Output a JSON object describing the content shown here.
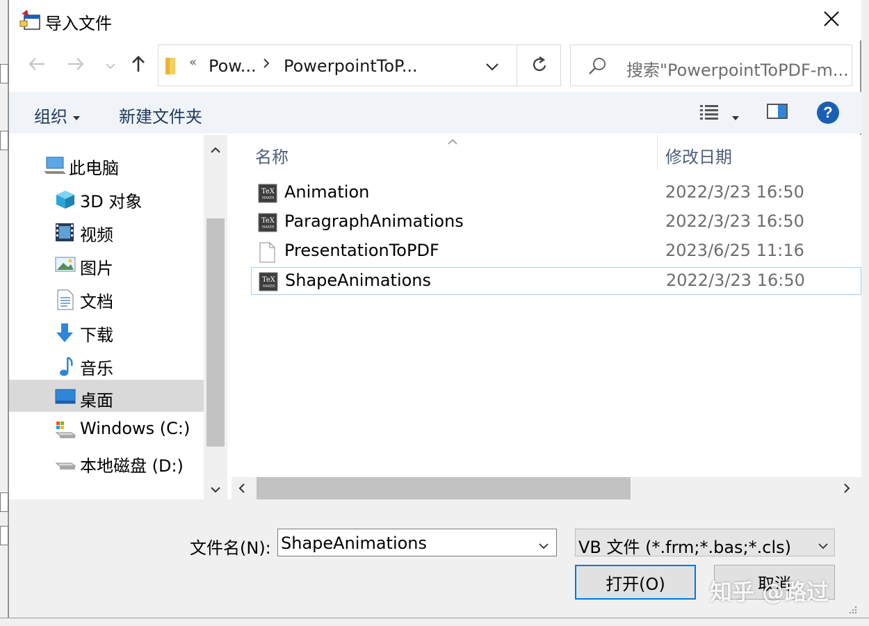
{
  "dialog": {
    "title": "导入文件",
    "close_icon": "close-icon"
  },
  "nav": {
    "back_icon": "arrow-left-icon",
    "forward_icon": "arrow-right-icon",
    "recent_icon": "chevron-down-icon",
    "up_icon": "arrow-up-icon"
  },
  "address": {
    "overflow": "«",
    "crumb1": "Pow...",
    "crumb2": "PowerpointToP..."
  },
  "search": {
    "placeholder": "搜索\"PowerpointToPDF-m..."
  },
  "toolbar": {
    "organize": "组织",
    "new_folder": "新建文件夹",
    "help": "?"
  },
  "sidebar": {
    "items": [
      {
        "label": "此电脑",
        "icon": "computer-icon"
      },
      {
        "label": "3D 对象",
        "icon": "cube-3d-icon"
      },
      {
        "label": "视频",
        "icon": "video-icon"
      },
      {
        "label": "图片",
        "icon": "picture-icon"
      },
      {
        "label": "文档",
        "icon": "document-icon"
      },
      {
        "label": "下载",
        "icon": "download-icon"
      },
      {
        "label": "音乐",
        "icon": "music-icon"
      },
      {
        "label": "桌面",
        "icon": "desktop-icon",
        "selected": true
      },
      {
        "label": "Windows (C:)",
        "icon": "drive-c-icon"
      },
      {
        "label": "本地磁盘 (D:)",
        "icon": "drive-d-icon"
      }
    ]
  },
  "files": {
    "columns": [
      "名称",
      "修改日期"
    ],
    "rows": [
      {
        "name": "Animation",
        "date": "2022/3/23 16:50",
        "icon": "texmaker-file-icon"
      },
      {
        "name": "ParagraphAnimations",
        "date": "2022/3/23 16:50",
        "icon": "texmaker-file-icon"
      },
      {
        "name": "PresentationToPDF",
        "date": "2023/6/25 11:16",
        "icon": "blank-file-icon"
      },
      {
        "name": "ShapeAnimations",
        "date": "2022/3/23 16:50",
        "icon": "texmaker-file-icon",
        "selected": true
      }
    ]
  },
  "footer": {
    "filename_label": "文件名(N):",
    "filename_value": "ShapeAnimations",
    "filetype_value": "VB 文件 (*.frm;*.bas;*.cls)",
    "open_label": "打开(O)",
    "cancel_label": "取消",
    "watermark": "知乎 @路过"
  }
}
